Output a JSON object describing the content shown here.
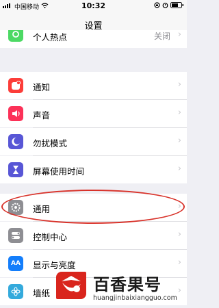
{
  "status": {
    "carrier": "中国移动",
    "time": "10:32",
    "icons": [
      "signal-icon",
      "wifi-icon",
      "orientation-lock-icon",
      "alarm-icon",
      "battery-icon"
    ]
  },
  "nav": {
    "title": "设置"
  },
  "rows": [
    {
      "label": "个人热点",
      "value": "关闭",
      "icon": "hotspot-icon",
      "color": "#4cd964"
    },
    {
      "label": "通知",
      "icon": "notifications-icon",
      "color": "#fc3d39"
    },
    {
      "label": "声音",
      "icon": "sounds-icon",
      "color": "#fc3158"
    },
    {
      "label": "勿扰模式",
      "icon": "do-not-disturb-icon",
      "color": "#5856d6"
    },
    {
      "label": "屏幕使用时间",
      "icon": "screen-time-icon",
      "color": "#5856d6"
    },
    {
      "label": "通用",
      "icon": "general-icon",
      "color": "#8e8e93"
    },
    {
      "label": "控制中心",
      "icon": "control-center-icon",
      "color": "#8e8e93"
    },
    {
      "label": "显示与亮度",
      "icon": "display-brightness-icon",
      "color": "#147efb",
      "glyph": "AA"
    },
    {
      "label": "墙纸",
      "icon": "wallpaper-icon",
      "color": "#34aadc"
    }
  ],
  "highlight_color": "#d8322a",
  "watermark": {
    "name": "百香果号",
    "url": "huangjinbaixiangguo.com"
  }
}
